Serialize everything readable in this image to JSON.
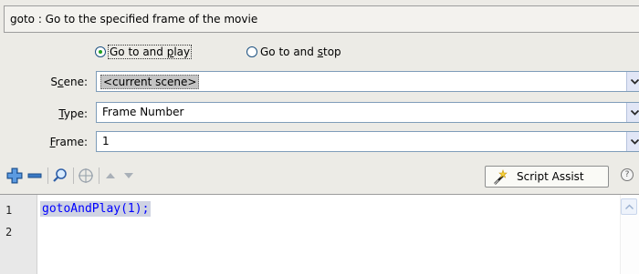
{
  "description": "goto : Go to the specified frame of the movie",
  "mode": {
    "options": [
      {
        "label_pre": "Go to and ",
        "label_u": "p",
        "label_post": "lay",
        "checked": true
      },
      {
        "label_pre": "Go to and ",
        "label_u": "s",
        "label_post": "top",
        "checked": false
      }
    ]
  },
  "fields": {
    "scene": {
      "label_pre": "S",
      "label_u": "c",
      "label_post": "ene:",
      "value": "<current scene>"
    },
    "type": {
      "label_pre": "",
      "label_u": "T",
      "label_post": "ype:",
      "value": "Frame Number"
    },
    "frame": {
      "label_pre": "",
      "label_u": "F",
      "label_post": "rame:",
      "value": "1"
    }
  },
  "toolbar": {
    "icons": [
      "add-statement-icon",
      "remove-statement-icon",
      "find-icon",
      "insert-target-path-icon",
      "move-up-icon",
      "move-down-icon"
    ],
    "script_assist_label": "Script Assist",
    "help_glyph": "?"
  },
  "editor": {
    "lines": [
      {
        "num": "1",
        "code": "gotoAndPlay(1);"
      },
      {
        "num": "2",
        "code": ""
      }
    ]
  },
  "colors": {
    "accent": "#21a121",
    "code": "#0000ff",
    "selection": "#cfd3e2"
  }
}
